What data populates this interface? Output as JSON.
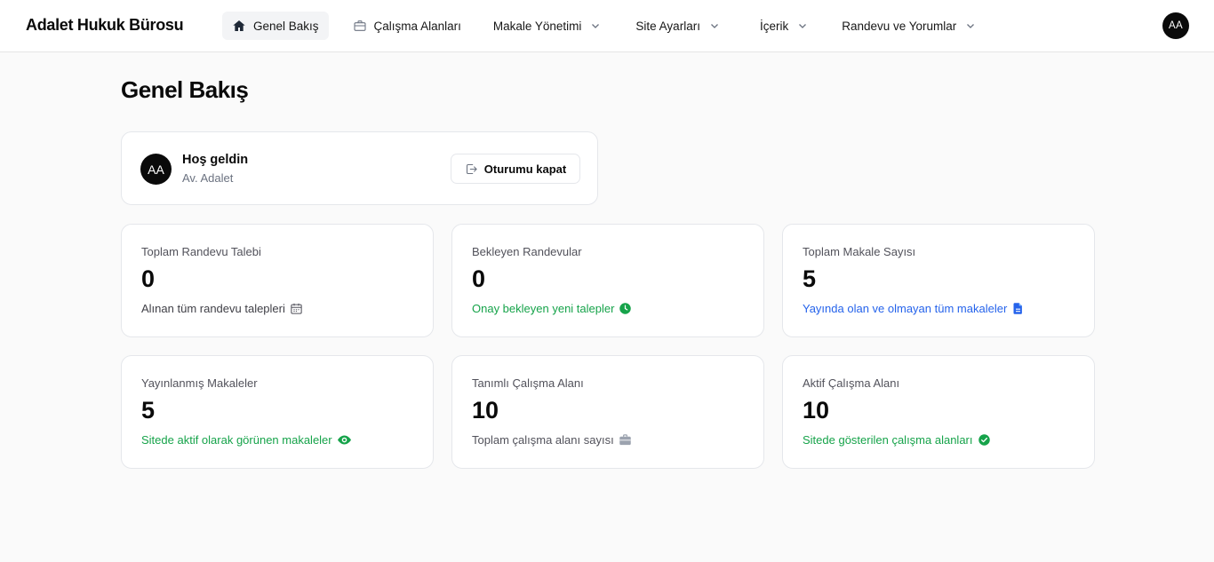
{
  "header": {
    "brand": "Adalet Hukuk Bürosu",
    "nav": [
      {
        "label": "Genel Bakış",
        "icon": "home-icon"
      },
      {
        "label": "Çalışma Alanları",
        "icon": "briefcase-icon"
      },
      {
        "label": "Makale Yönetimi",
        "icon": "chevron-down-icon"
      },
      {
        "label": "Site Ayarları",
        "icon": "chevron-down-icon"
      },
      {
        "label": "İçerik",
        "icon": "chevron-down-icon"
      },
      {
        "label": "Randevu ve Yorumlar",
        "icon": "chevron-down-icon"
      }
    ],
    "user_initials": "AA"
  },
  "page": {
    "title": "Genel Bakış"
  },
  "welcome": {
    "avatar_initials": "AA",
    "greeting": "Hoş geldin",
    "name": "Av. Adalet",
    "logout_label": "Oturumu kapat"
  },
  "stats": [
    {
      "label": "Toplam Randevu Talebi",
      "value": "0",
      "desc": "Alınan tüm randevu talepleri",
      "icon": "calendar-icon",
      "color": "#3f3f46"
    },
    {
      "label": "Bekleyen Randevular",
      "value": "0",
      "desc": "Onay bekleyen yeni talepler",
      "icon": "clock-icon",
      "color": "#16a34a"
    },
    {
      "label": "Toplam Makale Sayısı",
      "value": "5",
      "desc": "Yayında olan ve olmayan tüm makaleler",
      "icon": "document-icon",
      "color": "#2563eb"
    },
    {
      "label": "Yayınlanmış Makaleler",
      "value": "5",
      "desc": "Sitede aktif olarak görünen makaleler",
      "icon": "eye-icon",
      "color": "#16a34a"
    },
    {
      "label": "Tanımlı Çalışma Alanı",
      "value": "10",
      "desc": "Toplam çalışma alanı sayısı",
      "icon": "briefcase-icon",
      "color": "#52525b"
    },
    {
      "label": "Aktif Çalışma Alanı",
      "value": "10",
      "desc": "Sitede gösterilen çalışma alanları",
      "icon": "check-circle-icon",
      "color": "#16a34a"
    }
  ]
}
